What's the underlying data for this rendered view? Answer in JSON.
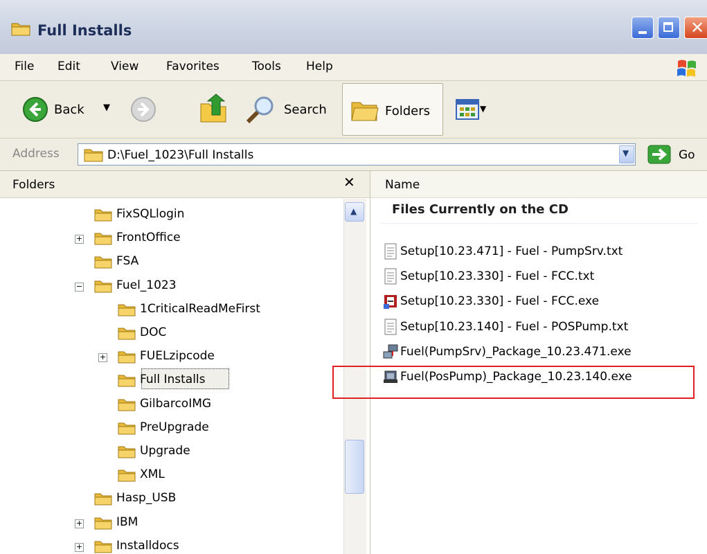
{
  "window": {
    "title": "Full Installs"
  },
  "menu": [
    "File",
    "Edit",
    "View",
    "Favorites",
    "Tools",
    "Help"
  ],
  "toolbar": {
    "back_label": "Back",
    "search_label": "Search",
    "folders_label": "Folders"
  },
  "address": {
    "label": "Address",
    "value": "D:\\Fuel_1023\\Full Installs",
    "go_label": "Go"
  },
  "folders_pane": {
    "title": "Folders",
    "items": [
      {
        "name": "FixSQLlogin",
        "depth": 1,
        "toggle": ""
      },
      {
        "name": "FrontOffice",
        "depth": 1,
        "toggle": "+"
      },
      {
        "name": "FSA",
        "depth": 1,
        "toggle": ""
      },
      {
        "name": "Fuel_1023",
        "depth": 1,
        "toggle": "-"
      },
      {
        "name": "1CriticalReadMeFirst",
        "depth": 2,
        "toggle": ""
      },
      {
        "name": "DOC",
        "depth": 2,
        "toggle": ""
      },
      {
        "name": "FUELzipcode",
        "depth": 2,
        "toggle": "+"
      },
      {
        "name": "Full Installs",
        "depth": 2,
        "toggle": "",
        "selected": true
      },
      {
        "name": "GilbarcoIMG",
        "depth": 2,
        "toggle": ""
      },
      {
        "name": "PreUpgrade",
        "depth": 2,
        "toggle": ""
      },
      {
        "name": "Upgrade",
        "depth": 2,
        "toggle": ""
      },
      {
        "name": "XML",
        "depth": 2,
        "toggle": ""
      },
      {
        "name": "Hasp_USB",
        "depth": 1,
        "toggle": ""
      },
      {
        "name": "IBM",
        "depth": 1,
        "toggle": "+"
      },
      {
        "name": "Installdocs",
        "depth": 1,
        "toggle": "+"
      }
    ]
  },
  "files_pane": {
    "column_header": "Name",
    "group_title": "Files Currently on the CD",
    "files": [
      {
        "name": "Setup[10.23.471] - Fuel - PumpSrv.txt",
        "icon": "text-file-icon"
      },
      {
        "name": "Setup[10.23.330] - Fuel - FCC.txt",
        "icon": "text-file-icon"
      },
      {
        "name": "Setup[10.23.330] - Fuel - FCC.exe",
        "icon": "setup-exe-icon"
      },
      {
        "name": "Setup[10.23.140] - Fuel - POSPump.txt",
        "icon": "text-file-icon"
      },
      {
        "name": "Fuel(PumpSrv)_Package_10.23.471.exe",
        "icon": "network-exe-icon"
      },
      {
        "name": "Fuel(PosPump)_Package_10.23.140.exe",
        "icon": "package-exe-icon",
        "highlighted": true
      }
    ]
  },
  "colors": {
    "highlight": "#e02020",
    "titlebar_text": "#1d2e58",
    "folder": "#f3c945"
  }
}
